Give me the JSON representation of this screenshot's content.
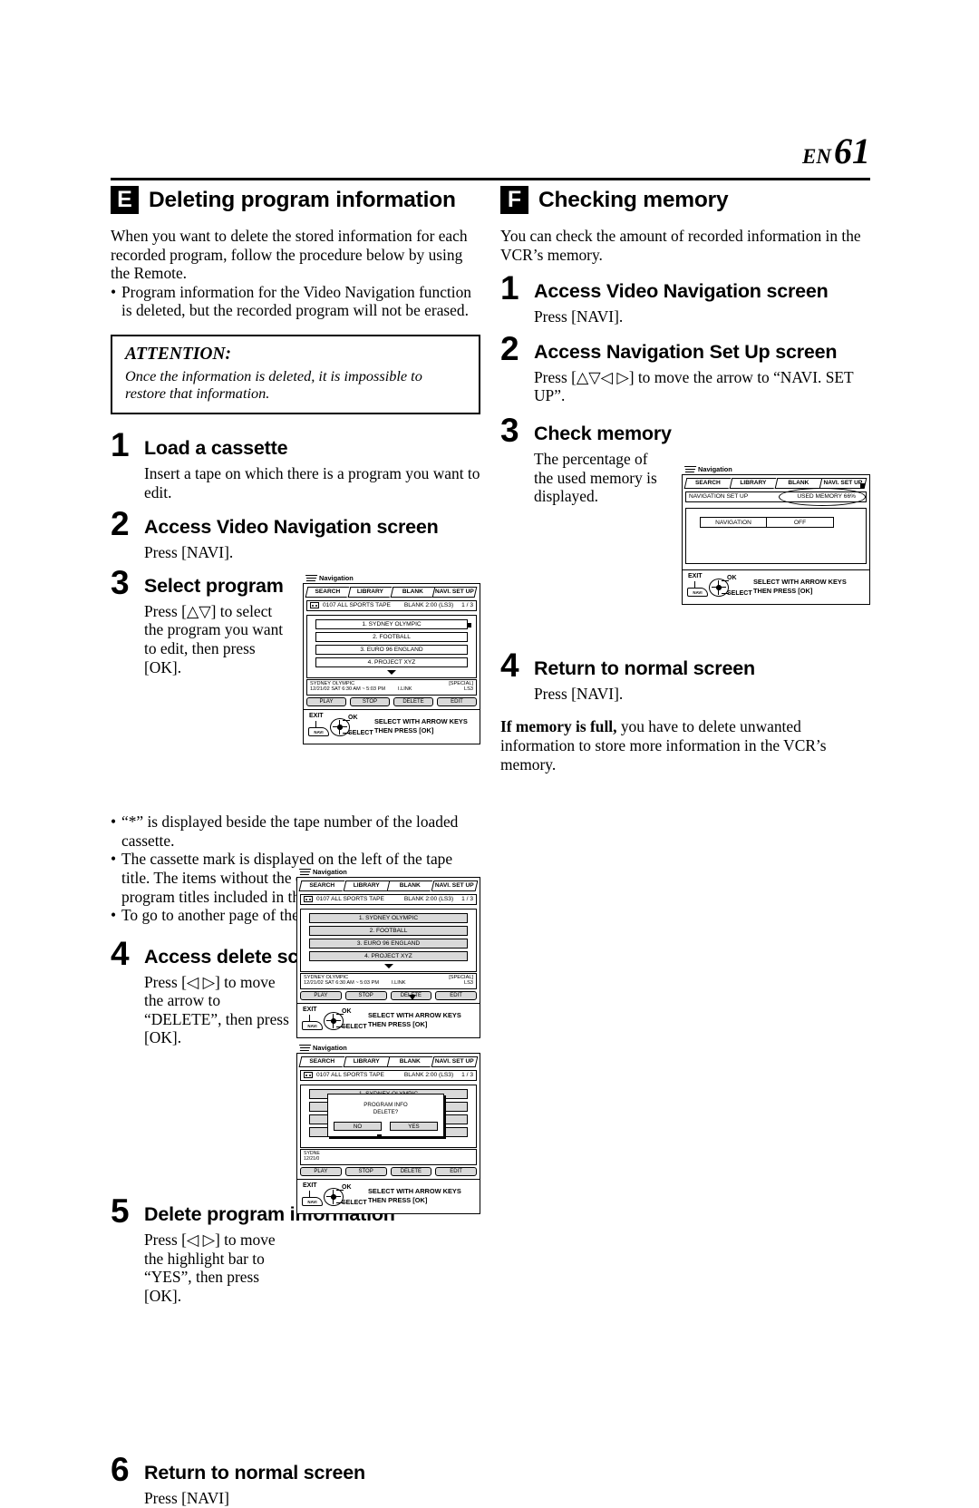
{
  "header": {
    "lang": "EN",
    "page_number": "61"
  },
  "left_section": {
    "letter": "E",
    "title": "Deleting program information",
    "intro": "When you want to delete the stored information for each recorded program, follow the procedure below by using the Remote.",
    "intro_bullets": [
      "Program information for the Video Navigation function is deleted, but the recorded program will not be erased."
    ],
    "attention": {
      "title": "ATTENTION:",
      "text": "Once the information is deleted, it is impossible to restore that information."
    },
    "steps": [
      {
        "num": "1",
        "title": "Load a cassette",
        "body": "Insert a tape on which there is a program you want to edit."
      },
      {
        "num": "2",
        "title": "Access Video Navigation screen",
        "body": "Press [NAVI]."
      },
      {
        "num": "3",
        "title": "Select program",
        "body": "Press [△▽] to select the program you want to edit, then press [OK]."
      },
      {
        "num": "4",
        "title": "Access delete screen",
        "body": "Press [◁ ▷] to move the arrow to “DELETE”, then press [OK]."
      },
      {
        "num": "5",
        "title": "Delete program information",
        "body": "Press [◁ ▷] to move the highlight bar to “YES”, then press [OK]."
      },
      {
        "num": "6",
        "title": "Return to normal screen",
        "body": "Press [NAVI]"
      }
    ],
    "mid_bullets": [
      "“*” is displayed beside the tape number of the loaded cassette.",
      "The cassette mark is displayed on the left of the tape title. The items without the cassette marks are the program titles included in the tape.",
      "To go to another page of the lists, press [<] or [>]."
    ]
  },
  "right_section": {
    "letter": "F",
    "title": "Checking memory",
    "intro": "You can check the amount of recorded information in the VCR’s memory.",
    "steps": [
      {
        "num": "1",
        "title": "Access Video Navigation screen",
        "body": "Press [NAVI]."
      },
      {
        "num": "2",
        "title": "Access Navigation Set Up screen",
        "body": "Press [△▽◁ ▷] to move the arrow to “NAVI. SET UP”."
      },
      {
        "num": "3",
        "title": "Check memory",
        "body": "The percentage of the used memory is displayed."
      },
      {
        "num": "4",
        "title": "Return to normal screen",
        "body": "Press [NAVI]."
      }
    ],
    "note_bold": "If memory is full,",
    "note_rest": " you have to delete unwanted information to store more information in the VCR’s memory."
  },
  "osd": {
    "label": "Navigation",
    "tabs": [
      "SEARCH",
      "LIBRARY",
      "BLANK",
      "NAVI. SET UP"
    ],
    "tape_info": "0107 ALL SPORTS TAPE",
    "blank_info": "BLANK 2:00 (LS3)",
    "page_info": "1 / 3",
    "programs": [
      "1. SYDNEY OLYMPIC",
      "2. FOOTBALL",
      "3. EURO 96 ENGLAND",
      "4. PROJECT XYZ"
    ],
    "detail": {
      "title": "SYDNEY OLYMPIC",
      "datetime": "12/21/02 SAT  6:30 AM ~ 5:03 PM",
      "link": "I.LINK",
      "special": "[SPECIAL]",
      "speed": "LS3"
    },
    "buttons": [
      "PLAY",
      "STOP",
      "DELETE",
      "EDIT"
    ],
    "footer_line1": "SELECT WITH ARROW KEYS",
    "footer_line2": "THEN PRESS [OK]",
    "remote": {
      "exit": "EXIT",
      "navi": "NAVI",
      "ok": "OK",
      "select": "SELECT"
    },
    "dialog": {
      "line1": "PROGRAM INFO",
      "line2": "DELETE?",
      "no": "NO",
      "yes": "YES"
    },
    "setup": {
      "header": "NAVIGATION SET UP",
      "used_memory": "USED MEMORY  66%",
      "row_key": "NAVIGATION",
      "row_value": "OFF"
    }
  }
}
